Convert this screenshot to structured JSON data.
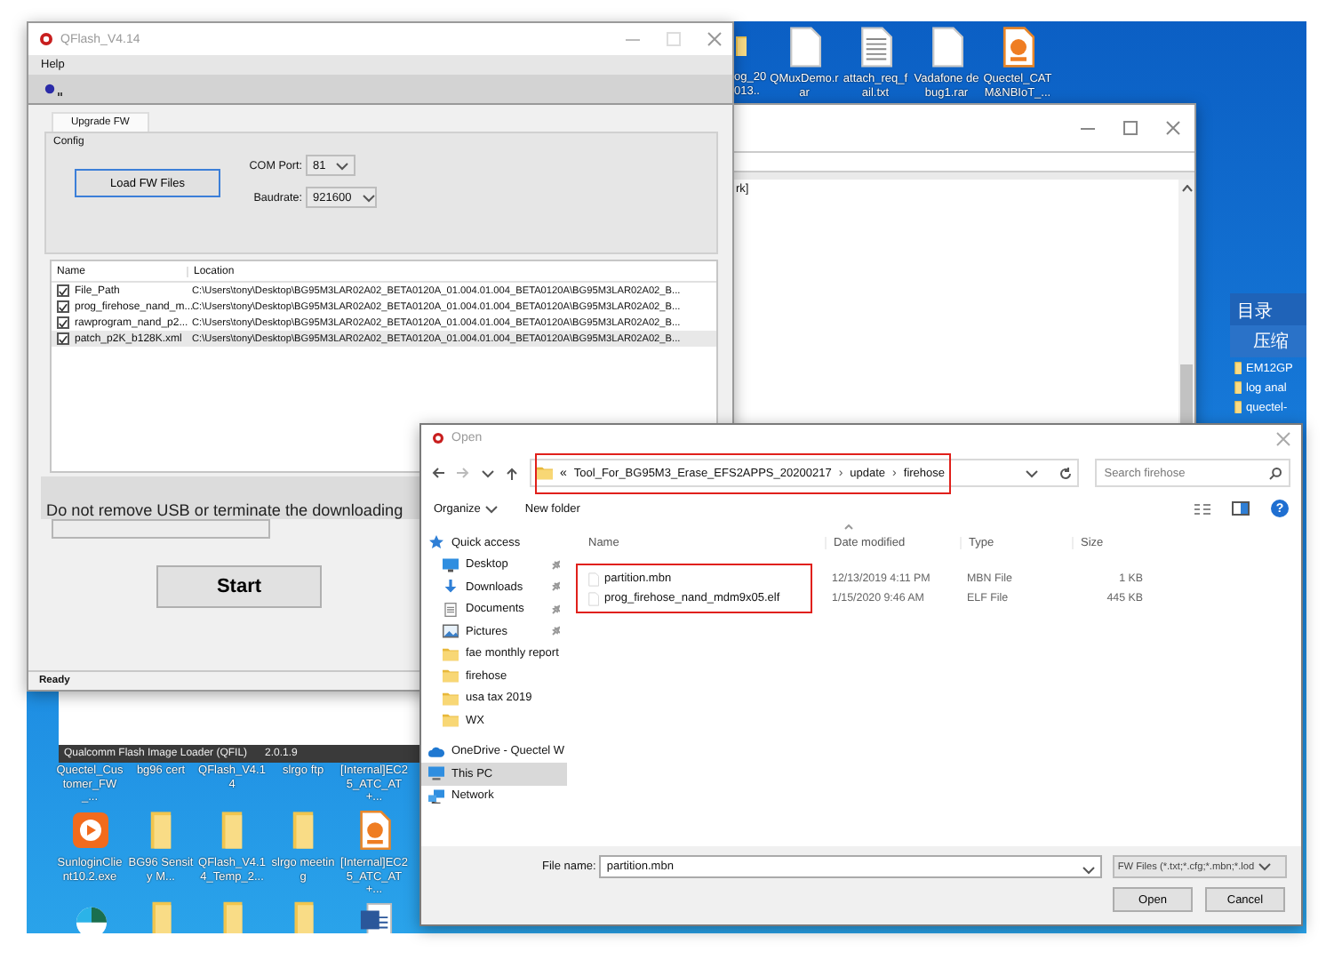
{
  "desktop_icons_top": [
    {
      "label": "og_20 013..",
      "kind": "folder"
    },
    {
      "label": "QMuxDemo.rar",
      "kind": "file"
    },
    {
      "label": "attach_req_fail.txt",
      "kind": "text"
    },
    {
      "label": "Vadafone debug1.rar",
      "kind": "file"
    },
    {
      "label": "Quectel_CAT M&NBIoT_...",
      "kind": "pdf"
    }
  ],
  "background_window": {
    "text": "rk]"
  },
  "side_panel": {
    "title": "目录",
    "heading": "压缩",
    "folders": [
      "EM12GP",
      "log anal",
      "quectel-"
    ]
  },
  "qflash": {
    "title": "QFlash_V4.14",
    "menu": [
      "Help"
    ],
    "tab": "Upgrade FW",
    "group": "Config",
    "load_button": "Load FW Files",
    "com_port": {
      "label": "COM Port:",
      "value": "81"
    },
    "baudrate": {
      "label": "Baudrate:",
      "value": "921600"
    },
    "table": {
      "columns": [
        "Name",
        "Location"
      ],
      "rows": [
        {
          "name": "File_Path",
          "location": "C:\\Users\\tony\\Desktop\\BG95M3LAR02A02_BETA0120A_01.004.01.004_BETA0120A\\BG95M3LAR02A02_B...",
          "checked": true
        },
        {
          "name": "prog_firehose_nand_m...",
          "location": "C:\\Users\\tony\\Desktop\\BG95M3LAR02A02_BETA0120A_01.004.01.004_BETA0120A\\BG95M3LAR02A02_B...",
          "checked": true
        },
        {
          "name": "rawprogram_nand_p2...",
          "location": "C:\\Users\\tony\\Desktop\\BG95M3LAR02A02_BETA0120A_01.004.01.004_BETA0120A\\BG95M3LAR02A02_B...",
          "checked": true
        },
        {
          "name": "patch_p2K_b128K.xml",
          "location": "C:\\Users\\tony\\Desktop\\BG95M3LAR02A02_BETA0120A_01.004.01.004_BETA0120A\\BG95M3LAR02A02_B...",
          "checked": true
        }
      ]
    },
    "message": "Do not remove USB or terminate the downloading",
    "progress": {
      "level": 0
    },
    "start_button": "Start",
    "status": "Ready"
  },
  "qfil_window": {
    "title": "Qualcomm Flash Image Loader (QFIL)",
    "version": "2.0.1.9"
  },
  "desktop_labels_hidden_icons": [
    "Quectel_Customer_FW_...",
    "bg96 cert",
    "QFlash_V4.14",
    "slrgo ftp",
    "[Internal]EC25_ATC_AT+..."
  ],
  "desktop_icons_bottom": [
    {
      "label": "SunloginClient10.2.exe",
      "kind": "sunlogin"
    },
    {
      "label": "BG96 Sensity M...",
      "kind": "folder"
    },
    {
      "label": "QFlash_V4.14_Temp_2...",
      "kind": "folder"
    },
    {
      "label": "slrgo meeting",
      "kind": "folder"
    },
    {
      "label": "[Internal]EC25_ATC_AT+...",
      "kind": "pdf"
    }
  ],
  "desktop_icons_last_row": [
    {
      "kind": "app"
    },
    {
      "kind": "folder"
    },
    {
      "kind": "folder"
    },
    {
      "kind": "folder"
    },
    {
      "kind": "word"
    }
  ],
  "open_dialog": {
    "title": "Open",
    "address": {
      "prefix": "«",
      "crumbs": [
        "Tool_For_BG95M3_Erase_EFS2APPS_20200217",
        "update",
        "firehose"
      ],
      "separator": "›"
    },
    "search": {
      "placeholder": "Search firehose"
    },
    "toolbar": {
      "organize": "Organize",
      "new_folder": "New folder",
      "help": "?"
    },
    "nav": [
      {
        "label": "Quick access",
        "kind": "star",
        "selected": false,
        "children": [
          {
            "label": "Desktop",
            "kind": "desktop",
            "pinned": true,
            "selected": false
          },
          {
            "label": "Downloads",
            "kind": "download",
            "pinned": true,
            "selected": false
          },
          {
            "label": "Documents",
            "kind": "documents",
            "pinned": true,
            "selected": false
          },
          {
            "label": "Pictures",
            "kind": "pictures",
            "pinned": true,
            "selected": false
          },
          {
            "label": "fae monthly report",
            "kind": "folder",
            "pinned": false,
            "selected": false
          },
          {
            "label": "firehose",
            "kind": "folder",
            "pinned": false,
            "selected": false
          },
          {
            "label": "usa tax 2019",
            "kind": "folder",
            "pinned": false,
            "selected": false
          },
          {
            "label": "WX",
            "kind": "folder",
            "pinned": false,
            "selected": false
          }
        ]
      },
      {
        "label": "OneDrive - Quectel W",
        "kind": "cloud",
        "selected": false
      },
      {
        "label": "This PC",
        "kind": "pc",
        "selected": true
      },
      {
        "label": "Network",
        "kind": "network",
        "selected": false
      }
    ],
    "columns": [
      "Name",
      "Date modified",
      "Type",
      "Size"
    ],
    "files": [
      {
        "name": "partition.mbn",
        "date": "12/13/2019 4:11 PM",
        "type": "MBN File",
        "size": "1 KB"
      },
      {
        "name": "prog_firehose_nand_mdm9x05.elf",
        "date": "1/15/2020 9:46 AM",
        "type": "ELF File",
        "size": "445 KB"
      }
    ],
    "file_name": {
      "label": "File name:",
      "value": "partition.mbn"
    },
    "filter": "FW Files (*.txt;*.cfg;*.mbn;*.lod",
    "buttons": [
      "Open",
      "Cancel"
    ]
  }
}
